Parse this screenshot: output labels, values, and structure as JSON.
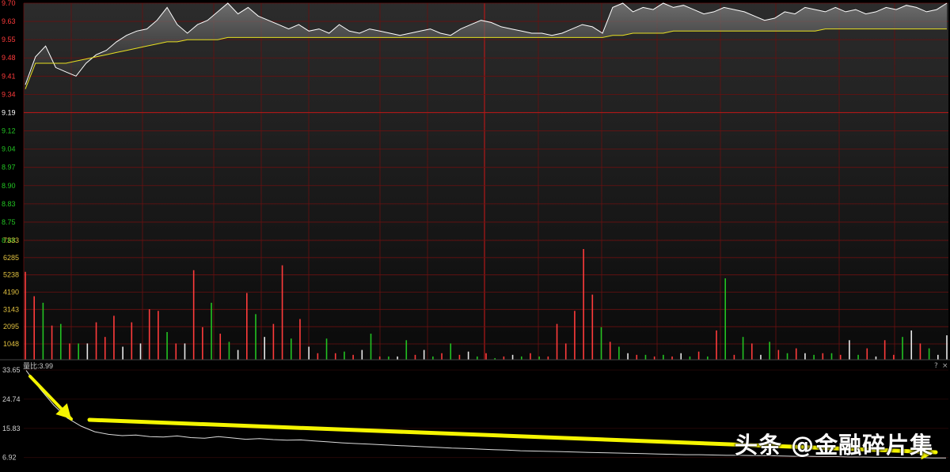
{
  "price_axis": {
    "ticks": [
      "9.70",
      "9.63",
      "9.55",
      "9.48",
      "9.41",
      "9.34",
      "9.19",
      "9.12",
      "9.04",
      "8.97",
      "8.90",
      "8.83",
      "8.75",
      "8.68"
    ],
    "prev_close_label": "9.19",
    "range": [
      8.68,
      9.7
    ],
    "up_color": "#ff3b3b",
    "down_color": "#22c322",
    "neutral_color": "#ffffff"
  },
  "volume_axis": {
    "ticks": [
      "7333",
      "6285",
      "5238",
      "4190",
      "3143",
      "2095",
      "1048"
    ],
    "tick_color": "#e0c040"
  },
  "ratio_axis": {
    "label": "量比:3.99",
    "ticks": [
      "33.65",
      "24.74",
      "15.83",
      "6.92"
    ]
  },
  "panel_buttons": {
    "help": "?",
    "close": "×"
  },
  "watermark": "头条 @金融碎片集",
  "colors": {
    "background": "#000000",
    "grid": "#6a1010",
    "price_line": "#ffffff",
    "avg_line": "#e8e020",
    "arrow": "#f5f500"
  },
  "chart_data": [
    {
      "type": "line",
      "title": "",
      "series": [
        {
          "values": [
            9.32,
            9.45,
            9.5,
            9.4,
            9.38,
            9.36,
            9.42,
            9.46,
            9.48,
            9.52,
            9.55,
            9.57,
            9.58,
            9.62,
            9.68,
            9.6,
            9.56,
            9.6,
            9.62,
            9.66,
            9.7,
            9.65,
            9.68,
            9.64,
            9.62,
            9.6,
            9.58,
            9.6,
            9.57,
            9.58,
            9.56,
            9.6,
            9.57,
            9.56,
            9.58,
            9.57,
            9.56,
            9.55,
            9.56,
            9.57,
            9.58,
            9.56,
            9.55,
            9.58,
            9.6,
            9.62,
            9.61,
            9.59,
            9.58,
            9.57,
            9.56,
            9.56,
            9.55,
            9.56,
            9.58,
            9.6,
            9.59,
            9.56,
            9.68,
            9.7,
            9.66,
            9.68,
            9.67,
            9.7,
            9.68,
            9.69,
            9.67,
            9.65,
            9.66,
            9.68,
            9.67,
            9.66,
            9.64,
            9.62,
            9.63,
            9.66,
            9.65,
            9.68,
            9.67,
            9.66,
            9.68,
            9.66,
            9.67,
            9.65,
            9.66,
            9.68,
            9.67,
            9.69,
            9.68,
            9.66,
            9.67,
            9.7
          ]
        },
        {
          "values": [
            9.3,
            9.42,
            9.42,
            9.42,
            9.42,
            9.43,
            9.44,
            9.45,
            9.46,
            9.47,
            9.48,
            9.49,
            9.5,
            9.51,
            9.52,
            9.52,
            9.53,
            9.53,
            9.53,
            9.53,
            9.54,
            9.54,
            9.54,
            9.54,
            9.54,
            9.54,
            9.54,
            9.54,
            9.54,
            9.54,
            9.54,
            9.54,
            9.54,
            9.54,
            9.54,
            9.54,
            9.54,
            9.54,
            9.54,
            9.54,
            9.54,
            9.54,
            9.54,
            9.54,
            9.54,
            9.54,
            9.54,
            9.54,
            9.54,
            9.54,
            9.54,
            9.54,
            9.54,
            9.54,
            9.54,
            9.54,
            9.54,
            9.54,
            9.55,
            9.55,
            9.56,
            9.56,
            9.56,
            9.56,
            9.57,
            9.57,
            9.57,
            9.57,
            9.57,
            9.57,
            9.57,
            9.57,
            9.57,
            9.57,
            9.57,
            9.57,
            9.57,
            9.57,
            9.57,
            9.58,
            9.58,
            9.58,
            9.58,
            9.58,
            9.58,
            9.58,
            9.58,
            9.58,
            9.58,
            9.58,
            9.58,
            9.58
          ]
        }
      ],
      "ylim": [
        8.68,
        9.7
      ]
    },
    {
      "type": "bar",
      "title": "",
      "values": [
        5400,
        3900,
        3500,
        2100,
        2200,
        1000,
        1000,
        1000,
        2300,
        1400,
        2700,
        800,
        2300,
        1000,
        3100,
        3000,
        1700,
        1000,
        1000,
        5500,
        2000,
        3500,
        1600,
        1100,
        600,
        4100,
        2800,
        1400,
        2200,
        5800,
        1300,
        2500,
        800,
        400,
        1300,
        400,
        500,
        300,
        600,
        1600,
        200,
        200,
        200,
        1200,
        300,
        600,
        200,
        400,
        1000,
        300,
        500,
        200,
        400,
        100,
        200,
        300,
        200,
        400,
        200,
        200,
        2200,
        1000,
        3000,
        6800,
        4000,
        2000,
        1100,
        800,
        400,
        300,
        300,
        200,
        300,
        200,
        400,
        200,
        500,
        200,
        1800,
        5000,
        300,
        1400,
        1000,
        300,
        1100,
        600,
        400,
        700,
        400,
        300,
        400,
        400,
        300,
        1200,
        300,
        700,
        200,
        1200,
        300,
        1400,
        1800,
        1000,
        700,
        300,
        1500
      ],
      "signs": [
        "up",
        "up",
        "down",
        "up",
        "down",
        "up",
        "down",
        "neutral",
        "up",
        "up",
        "up",
        "neutral",
        "up",
        "neutral",
        "up",
        "up",
        "down",
        "up",
        "neutral",
        "up",
        "up",
        "down",
        "up",
        "down",
        "neutral",
        "up",
        "down",
        "neutral",
        "up",
        "up",
        "down",
        "up",
        "neutral",
        "up",
        "down",
        "up",
        "down",
        "up",
        "neutral",
        "down",
        "up",
        "down",
        "neutral",
        "down",
        "up",
        "neutral",
        "down",
        "up",
        "down",
        "up",
        "neutral",
        "down",
        "up",
        "down",
        "up",
        "neutral",
        "down",
        "up",
        "down",
        "up",
        "up",
        "up",
        "up",
        "up",
        "up",
        "down",
        "up",
        "down",
        "neutral",
        "up",
        "down",
        "up",
        "down",
        "up",
        "neutral",
        "down",
        "up",
        "down",
        "up",
        "down",
        "up",
        "down",
        "up",
        "neutral",
        "down",
        "up",
        "down",
        "up",
        "neutral",
        "down",
        "up",
        "down",
        "up",
        "neutral",
        "down",
        "up",
        "neutral",
        "up",
        "up",
        "down",
        "neutral",
        "up",
        "down",
        "neutral"
      ],
      "ylim": [
        0,
        7333
      ]
    },
    {
      "type": "line",
      "title": "",
      "series": [
        {
          "values": [
            33.5,
            28.0,
            23.0,
            19.0,
            16.5,
            14.8,
            14.0,
            13.6,
            13.8,
            13.3,
            13.2,
            13.5,
            13.0,
            12.8,
            13.3,
            12.9,
            12.5,
            12.7,
            12.4,
            12.2,
            12.3,
            12.0,
            11.7,
            11.4,
            11.2,
            11.0,
            10.8,
            10.6,
            10.4,
            10.2,
            10.0,
            9.8,
            9.7,
            9.5,
            9.3,
            9.2,
            9.0,
            8.9,
            8.8,
            8.7,
            8.6,
            8.5,
            8.4,
            8.3,
            8.2,
            8.1,
            8.0,
            7.9,
            7.8,
            7.8,
            7.7,
            7.6,
            7.6,
            7.5,
            7.5,
            7.4,
            7.3,
            7.3,
            7.2,
            7.2,
            7.1,
            7.1,
            7.0,
            7.0,
            6.9,
            6.9,
            6.8,
            6.8
          ]
        }
      ],
      "ylim": [
        2.5,
        33.65
      ]
    }
  ]
}
